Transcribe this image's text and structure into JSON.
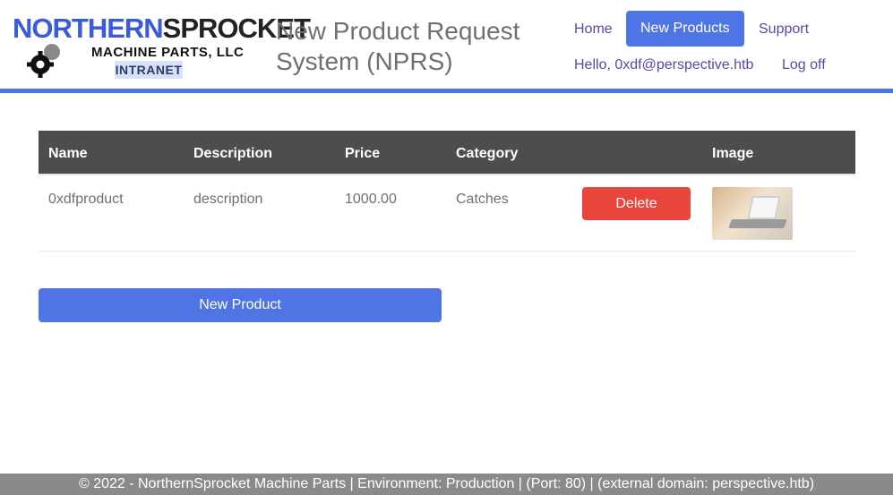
{
  "brand": {
    "logo_part1": "NORTHERN",
    "logo_part2": "SPROCKET",
    "logo_line2": "MACHINE PARTS, LLC",
    "logo_line3": "INTRANET",
    "app_title": "New Product Request System (NPRS)"
  },
  "nav": {
    "home": "Home",
    "new_products": "New Products",
    "support": "Support",
    "greeting": "Hello, 0xdf@perspective.htb",
    "logoff": "Log off"
  },
  "table": {
    "headers": [
      "Name",
      "Description",
      "Price",
      "Category",
      "Image"
    ],
    "rows": [
      {
        "name": "0xdfproduct",
        "description": "description",
        "price": "1000.00",
        "category": "Catches",
        "action": "Delete"
      }
    ]
  },
  "actions": {
    "new_product": "New Product"
  },
  "footer": {
    "text": "© 2022 - NorthernSprocket Machine Parts | Environment: Production | (Port: 80) | (external domain: perspective.htb)"
  },
  "colors": {
    "accent": "#4f74e3",
    "danger": "#e8463c",
    "table_header": "#4d4d4d",
    "footer": "#8a8a8a"
  }
}
